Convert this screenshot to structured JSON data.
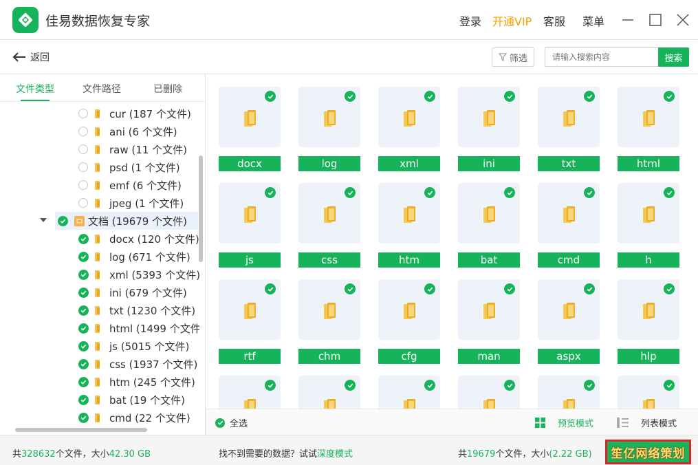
{
  "app": {
    "title": "佳易数据恢复专家"
  },
  "topnav": {
    "login": "登录",
    "vip": "开通VIP",
    "service": "客服",
    "menu": "菜单"
  },
  "toolbar": {
    "back": "返回",
    "filter": "筛选",
    "search_placeholder": "请输入搜索内容",
    "search_button": "搜索"
  },
  "sidebar": {
    "tabs": [
      "文件类型",
      "文件路径",
      "已删除"
    ],
    "tree": [
      {
        "label": "cur (187 个文件)",
        "checked": false
      },
      {
        "label": "ani (6 个文件)",
        "checked": false
      },
      {
        "label": "raw (11 个文件)",
        "checked": false
      },
      {
        "label": "psd (1 个文件)",
        "checked": false
      },
      {
        "label": "emf (6 个文件)",
        "checked": false
      },
      {
        "label": "jpeg (1 个文件)",
        "checked": false
      },
      {
        "label": "文档 (19679 个文件)",
        "checked": true,
        "group": true
      },
      {
        "label": "docx (120 个文件)",
        "checked": true
      },
      {
        "label": "log (671 个文件)",
        "checked": true
      },
      {
        "label": "xml (5393 个文件)",
        "checked": true
      },
      {
        "label": "ini (679 个文件)",
        "checked": true
      },
      {
        "label": "txt (1230 个文件)",
        "checked": true
      },
      {
        "label": "html (1499 个文件)",
        "checked": true
      },
      {
        "label": "js (5015 个文件)",
        "checked": true
      },
      {
        "label": "css (1937 个文件)",
        "checked": true
      },
      {
        "label": "htm (245 个文件)",
        "checked": true
      },
      {
        "label": "bat (19 个文件)",
        "checked": true
      },
      {
        "label": "cmd (22 个文件)",
        "checked": true
      }
    ]
  },
  "grid": {
    "items": [
      "docx",
      "log",
      "xml",
      "ini",
      "txt",
      "html",
      "js",
      "css",
      "htm",
      "bat",
      "cmd",
      "h",
      "rtf",
      "chm",
      "cfg",
      "man",
      "aspx",
      "hlp",
      "",
      "",
      "",
      "",
      "",
      ""
    ]
  },
  "gridbar": {
    "select_all": "全选",
    "preview_mode": "预览模式",
    "list_mode": "列表模式"
  },
  "status": {
    "total_prefix": "共",
    "total_count": "328632",
    "total_mid": "个文件，大小",
    "total_size": "42.30 GB",
    "hint": "找不到需要的数据？试试",
    "deep_mode": "深度模式",
    "sel_prefix": "共",
    "sel_count": "19679",
    "sel_mid": "个文件，大小",
    "sel_size": "(2.22 GB)",
    "recover_button": "笙亿网络策划"
  },
  "colors": {
    "accent": "#17b35a",
    "vip": "#f5a100",
    "highlight": "#e9f2fb"
  }
}
